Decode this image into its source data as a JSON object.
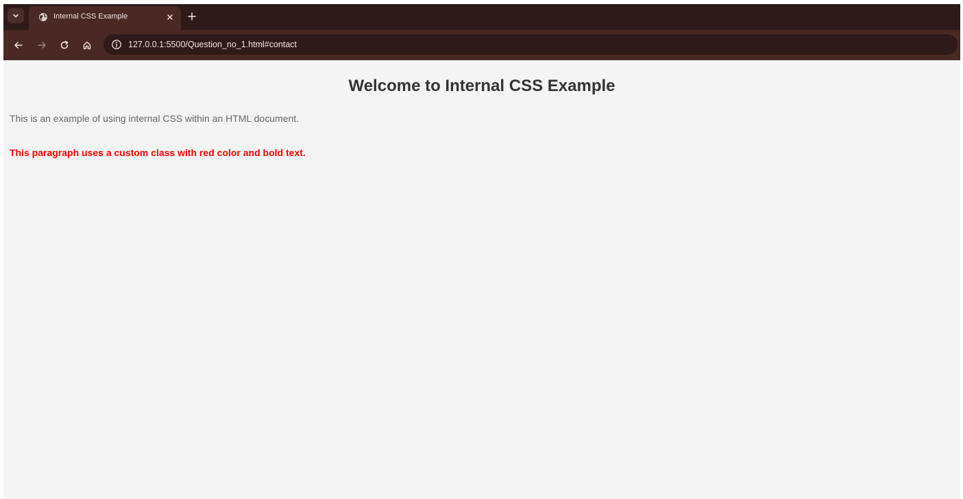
{
  "browser": {
    "tab": {
      "title": "Internal CSS Example",
      "favicon": "globe-icon",
      "close": "close-icon"
    },
    "tab_search_icon": "chevron-down-icon",
    "new_tab_icon": "plus-icon",
    "toolbar": {
      "back_icon": "arrow-left-icon",
      "forward_icon": "arrow-right-icon",
      "reload_icon": "reload-icon",
      "home_icon": "home-icon"
    },
    "address_bar": {
      "site_info_icon": "info-icon",
      "url": "127.0.0.1:5500/Question_no_1.html#contact"
    },
    "colors": {
      "tabstrip": "#2e1a18",
      "toolbar": "#4a2824"
    }
  },
  "page": {
    "heading": "Welcome to Internal CSS Example",
    "paragraph": "This is an example of using internal CSS within an HTML document.",
    "custom_paragraph": "This paragraph uses a custom class with red color and bold text.",
    "colors": {
      "background": "#f4f4f4",
      "heading": "#333333",
      "paragraph": "#666666",
      "custom_paragraph": "#ff0000"
    }
  }
}
